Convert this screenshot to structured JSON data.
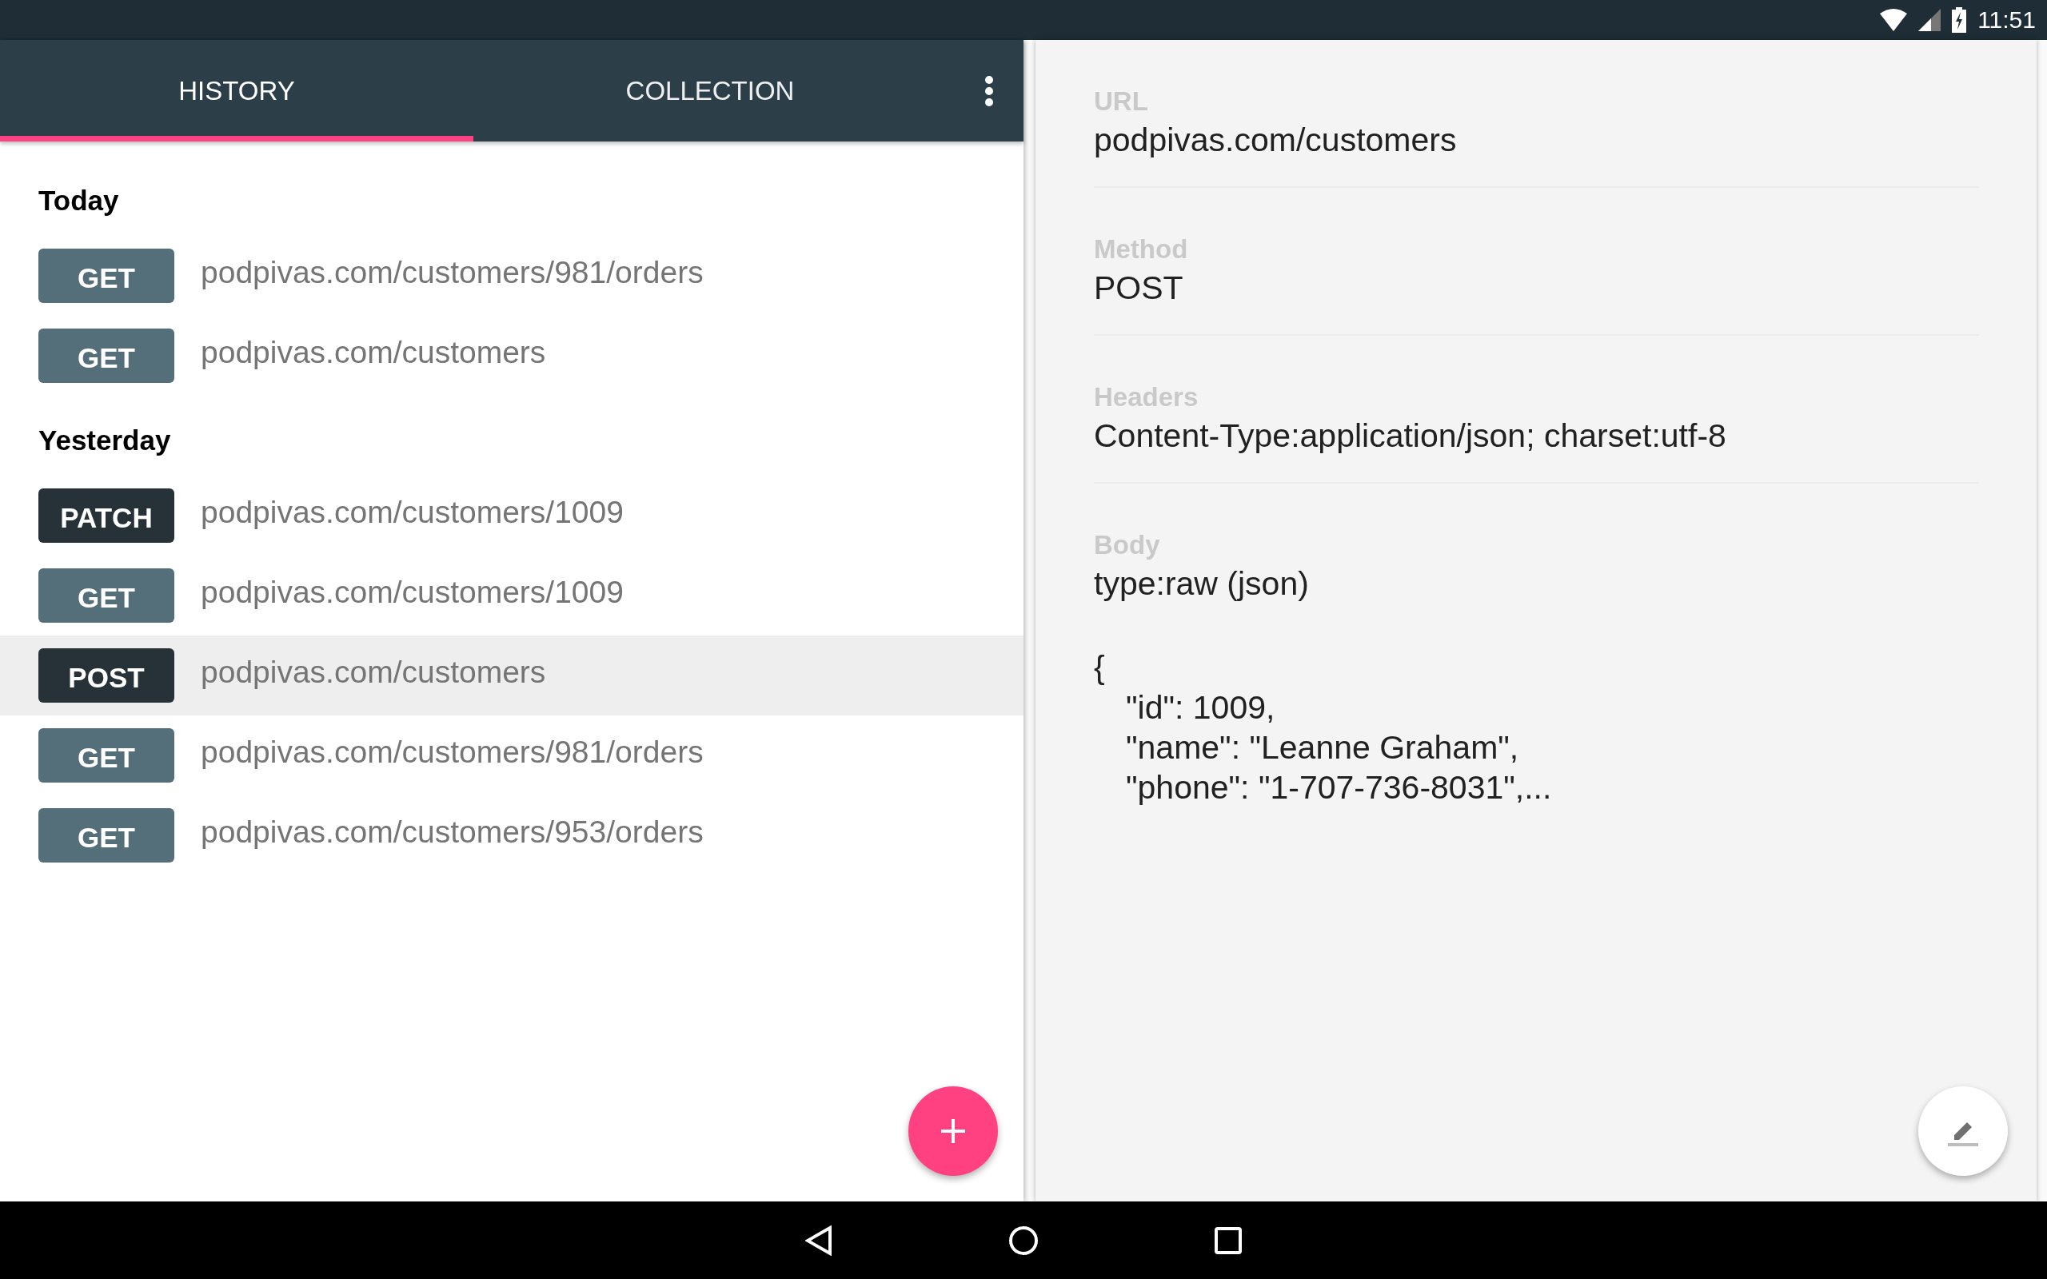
{
  "status_bar": {
    "time": "11:51"
  },
  "tabs": [
    {
      "label": "HISTORY",
      "selected": true
    },
    {
      "label": "COLLECTION",
      "selected": false
    }
  ],
  "history": [
    {
      "title": "Today",
      "items": [
        {
          "method": "GET",
          "color": "#546e7a",
          "url": "podpivas.com/customers/981/orders",
          "selected": false
        },
        {
          "method": "GET",
          "color": "#546e7a",
          "url": "podpivas.com/customers",
          "selected": false
        }
      ]
    },
    {
      "title": "Yesterday",
      "items": [
        {
          "method": "PATCH",
          "color": "#263238",
          "url": "podpivas.com/customers/1009",
          "selected": false
        },
        {
          "method": "GET",
          "color": "#546e7a",
          "url": "podpivas.com/customers/1009",
          "selected": false
        },
        {
          "method": "POST",
          "color": "#263238",
          "url": "podpivas.com/customers",
          "selected": true
        },
        {
          "method": "GET",
          "color": "#546e7a",
          "url": "podpivas.com/customers/981/orders",
          "selected": false
        },
        {
          "method": "GET",
          "color": "#546e7a",
          "url": "podpivas.com/customers/953/orders",
          "selected": false
        }
      ]
    }
  ],
  "details": {
    "fields": [
      {
        "label": "URL",
        "value": "podpivas.com/customers"
      },
      {
        "label": "Method",
        "value": "POST"
      },
      {
        "label": "Headers",
        "value": "Content-Type:application/json; charset:utf-8"
      }
    ],
    "body": {
      "label": "Body",
      "type": "type:raw (json)",
      "open": "{",
      "lines": [
        "\"id\": 1009,",
        "\"name\": \"Leanne Graham\",",
        "\"phone\": \"1-707-736-8031\",..."
      ]
    }
  }
}
